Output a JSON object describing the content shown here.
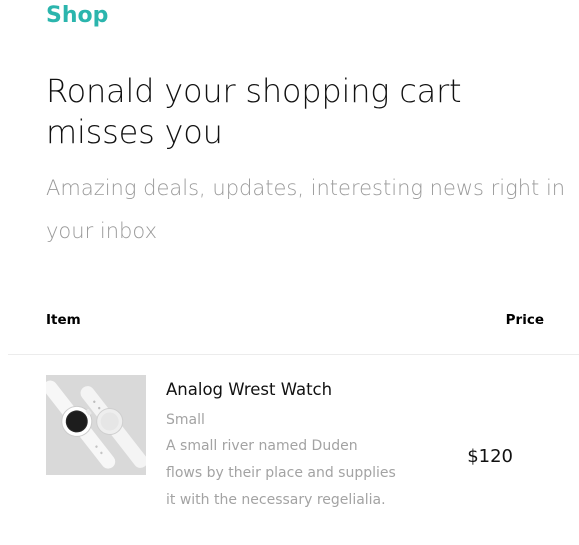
{
  "brand": {
    "label": "Shop",
    "color": "#2bb5ad"
  },
  "hero": {
    "headline": "Ronald your shopping cart misses you",
    "subline": "Amazing deals, updates, interesting news right in your inbox"
  },
  "table": {
    "headers": {
      "item": "Item",
      "price": "Price"
    },
    "rows": [
      {
        "thumbnail_icon": "smartwatch-image",
        "name": "Analog Wrest Watch",
        "variant": "Small",
        "description": "A small river named Duden flows by their place and supplies it with the necessary regelialia.",
        "price": "$120"
      }
    ]
  }
}
